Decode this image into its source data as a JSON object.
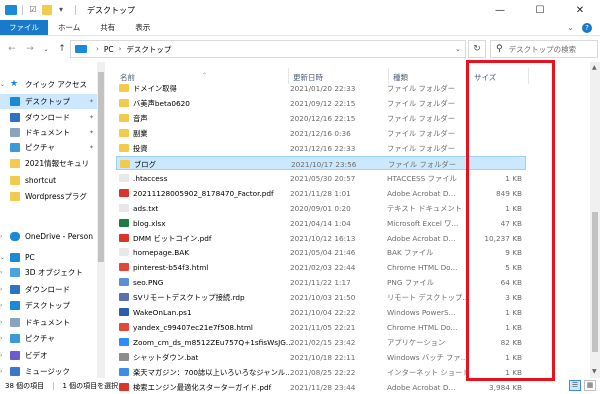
{
  "window": {
    "title": "デスクトップ",
    "minimize": "—",
    "maximize": "☐",
    "close": "✕"
  },
  "ribbon": {
    "tabs": [
      "ファイル",
      "ホーム",
      "共有",
      "表示"
    ]
  },
  "address": {
    "crumbs": [
      "PC",
      "デスクトップ"
    ],
    "search_placeholder": "デスクトップの検索"
  },
  "nav": {
    "quick_access": "クイック アクセス",
    "pinned": [
      {
        "label": "デスクトップ",
        "color": "#1a8ad8"
      },
      {
        "label": "ダウンロード",
        "color": "#2d72c4"
      },
      {
        "label": "ドキュメント",
        "color": "#8aa4c0"
      },
      {
        "label": "ピクチャ",
        "color": "#3c9ad6"
      }
    ],
    "folders": [
      "2021情報セキュリ",
      "shortcut",
      "Wordpressプラグ"
    ],
    "onedrive": "OneDrive - Person",
    "pc": "PC",
    "pc_items": [
      {
        "label": "3D オブジェクト",
        "color": "#4aa3df"
      },
      {
        "label": "ダウンロード",
        "color": "#2d72c4"
      },
      {
        "label": "デスクトップ",
        "color": "#1a8ad8"
      },
      {
        "label": "ドキュメント",
        "color": "#8aa4c0"
      },
      {
        "label": "ピクチャ",
        "color": "#3c9ad6"
      },
      {
        "label": "ビデオ",
        "color": "#6b5bd0"
      },
      {
        "label": "ミュージック",
        "color": "#3c78c8"
      }
    ]
  },
  "columns": {
    "name": "名前",
    "date": "更新日時",
    "type": "種類",
    "size": "サイズ"
  },
  "files": [
    {
      "name": "ドメイン取得",
      "date": "2021/01/20 22:33",
      "type": "ファイル フォルダー",
      "size": "",
      "color": "#f3c94e"
    },
    {
      "name": "バ美声beta0620",
      "date": "2021/09/12 22:15",
      "type": "ファイル フォルダー",
      "size": "",
      "color": "#f3c94e"
    },
    {
      "name": "音声",
      "date": "2020/12/16 22:15",
      "type": "ファイル フォルダー",
      "size": "",
      "color": "#f3c94e"
    },
    {
      "name": "副業",
      "date": "2021/12/16 0:36",
      "type": "ファイル フォルダー",
      "size": "",
      "color": "#f3c94e"
    },
    {
      "name": "投資",
      "date": "2021/12/16 22:33",
      "type": "ファイル フォルダー",
      "size": "",
      "color": "#f3c94e"
    },
    {
      "name": "ブログ",
      "date": "2021/10/17 23:56",
      "type": "ファイル フォルダー",
      "size": "",
      "color": "#f3c94e"
    },
    {
      "name": ".htaccess",
      "date": "2021/05/30 20:57",
      "type": "HTACCESS ファイル",
      "size": "1 KB",
      "color": "#e8e8e8"
    },
    {
      "name": "20211128005902_8178470_Factor.pdf",
      "date": "2021/11/28 1:01",
      "type": "Adobe Acrobat D...",
      "size": "849 KB",
      "color": "#d9352b"
    },
    {
      "name": "ads.txt",
      "date": "2020/09/01 0:20",
      "type": "テキスト ドキュメント",
      "size": "1 KB",
      "color": "#e8e8e8"
    },
    {
      "name": "blog.xlsx",
      "date": "2021/04/14 1:04",
      "type": "Microsoft Excel ワ...",
      "size": "47 KB",
      "color": "#1f7a45"
    },
    {
      "name": "DMM ビットコイン.pdf",
      "date": "2021/10/12 16:13",
      "type": "Adobe Acrobat D...",
      "size": "10,237 KB",
      "color": "#d9352b"
    },
    {
      "name": "homepage.BAK",
      "date": "2021/05/04 21:46",
      "type": "BAK ファイル",
      "size": "9 KB",
      "color": "#e8e8e8"
    },
    {
      "name": "pinterest-b54f3.html",
      "date": "2021/02/03 22:44",
      "type": "Chrome HTML Do...",
      "size": "5 KB",
      "color": "#e0483a"
    },
    {
      "name": "seo.PNG",
      "date": "2021/11/22 1:17",
      "type": "PNG ファイル",
      "size": "64 KB",
      "color": "#5b8fd6"
    },
    {
      "name": "SVリモートデスクトップ接続.rdp",
      "date": "2021/10/03 21:50",
      "type": "リモート デスクトップ...",
      "size": "3 KB",
      "color": "#5a6fb0"
    },
    {
      "name": "WakeOnLan.ps1",
      "date": "2021/10/04 22:22",
      "type": "Windows PowerS...",
      "size": "1 KB",
      "color": "#2b5fa8"
    },
    {
      "name": "yandex_c99407ec21e7f508.html",
      "date": "2021/11/05 22:21",
      "type": "Chrome HTML Do...",
      "size": "1 KB",
      "color": "#e0483a"
    },
    {
      "name": "Zoom_cm_ds_m8512ZEu757Q+1sfisWsJG...",
      "date": "2021/02/15 23:42",
      "type": "アプリケーション",
      "size": "82 KB",
      "color": "#2d8cff"
    },
    {
      "name": "シャットダウン.bat",
      "date": "2021/10/18 22:11",
      "type": "Windows バッチ ファ...",
      "size": "1 KB",
      "color": "#8c8c8c"
    },
    {
      "name": "楽天マガジン：700誌以上いろいろなジャンル...",
      "date": "2021/08/25 22:22",
      "type": "インターネット ショート...",
      "size": "1 KB",
      "color": "#3a8ee6"
    },
    {
      "name": "検索エンジン最適化スターターガイド.pdf",
      "date": "2021/11/28 23:44",
      "type": "Adobe Acrobat D...",
      "size": "3,984 KB",
      "color": "#d9352b"
    }
  ],
  "selected_index": 5,
  "status": {
    "count": "38 個の項目",
    "selected": "1 個の項目を選択"
  },
  "highlight_color": "#e8121f"
}
